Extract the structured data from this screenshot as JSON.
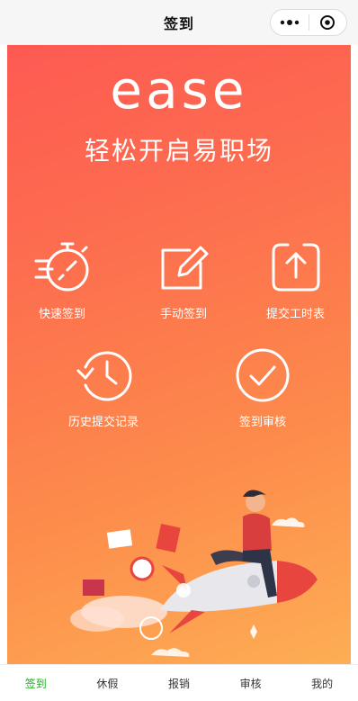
{
  "navbar": {
    "title": "签到"
  },
  "brand": {
    "logo_text": "ease",
    "tagline": "轻松开启易职场"
  },
  "features": [
    {
      "label": "快速签到"
    },
    {
      "label": "手动签到"
    },
    {
      "label": "提交工时表"
    },
    {
      "label": "历史提交记录"
    },
    {
      "label": "签到审核"
    }
  ],
  "tabs": [
    {
      "label": "签到",
      "active": true
    },
    {
      "label": "休假"
    },
    {
      "label": "报销"
    },
    {
      "label": "审核"
    },
    {
      "label": "我的"
    }
  ],
  "colors": {
    "accent_active_tab": "#1aad19",
    "gradient_start": "#fd5a52",
    "gradient_end": "#fdae54"
  }
}
